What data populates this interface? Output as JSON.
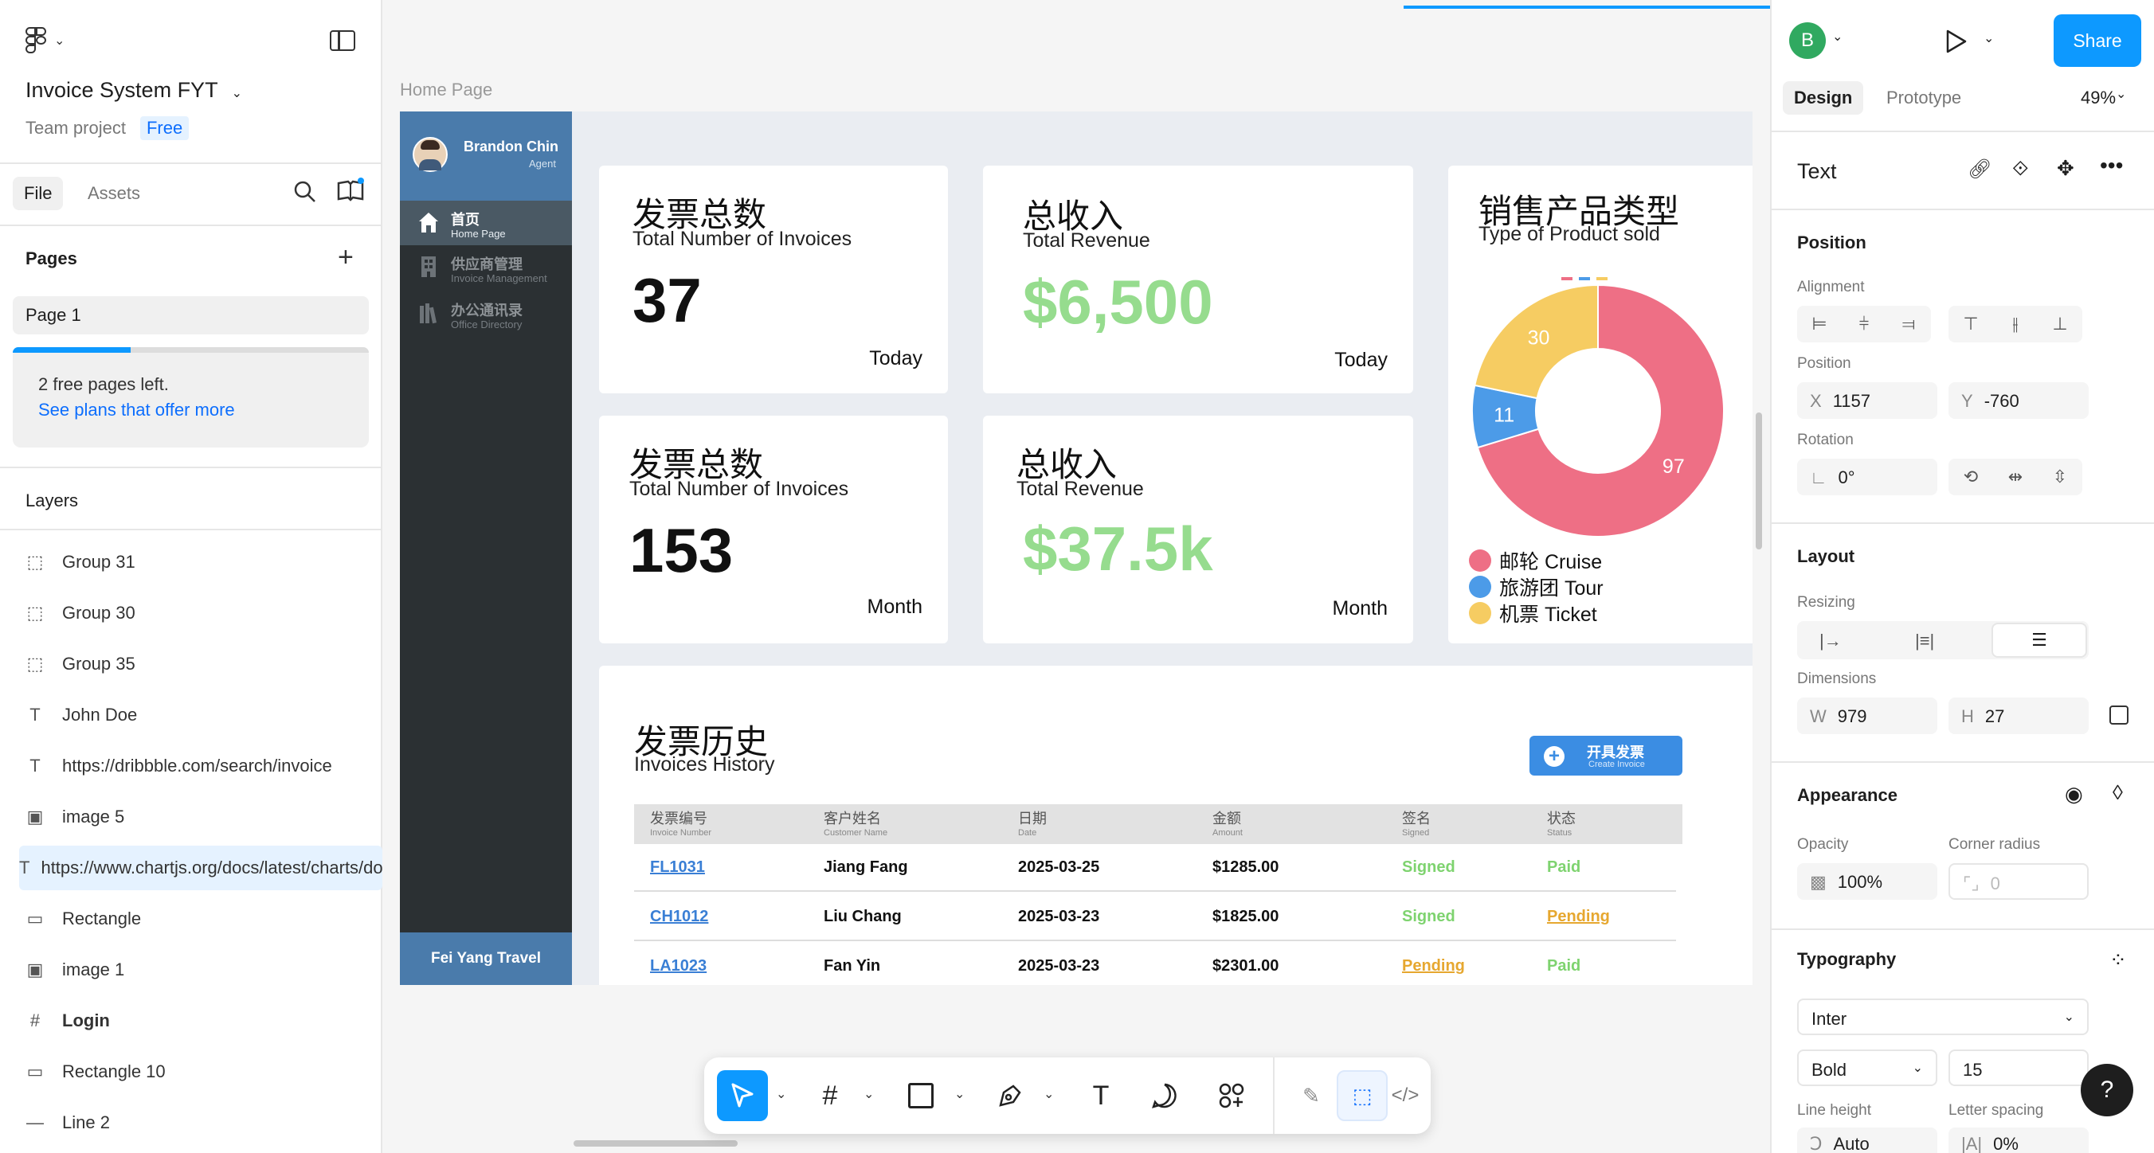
{
  "left": {
    "project_title": "Invoice System FYT",
    "project_team": "Team project",
    "project_plan": "Free",
    "tabs": [
      "File",
      "Assets"
    ],
    "pages_heading": "Pages",
    "page_item": "Page 1",
    "free_pages": "2 free pages left.",
    "see_plans": "See plans that offer more",
    "layers_heading": "Layers",
    "layers": [
      {
        "icon": "group-icon",
        "glyph": "⬚",
        "label": "Group 31"
      },
      {
        "icon": "group-icon",
        "glyph": "⬚",
        "label": "Group 30"
      },
      {
        "icon": "group-icon",
        "glyph": "⬚",
        "label": "Group 35"
      },
      {
        "icon": "text-icon",
        "glyph": "T",
        "label": "John Doe"
      },
      {
        "icon": "text-icon",
        "glyph": "T",
        "label": "https://dribbble.com/search/invoice"
      },
      {
        "icon": "image-icon",
        "glyph": "▣",
        "label": "image 5"
      },
      {
        "icon": "text-icon",
        "glyph": "T",
        "label": "https://www.chartjs.org/docs/latest/charts/doughnut.html"
      },
      {
        "icon": "rectangle-icon",
        "glyph": "▭",
        "label": "Rectangle"
      },
      {
        "icon": "image-icon",
        "glyph": "▣",
        "label": "image 1"
      },
      {
        "icon": "frame-icon",
        "glyph": "#",
        "label": "Login"
      },
      {
        "icon": "rectangle-icon",
        "glyph": "▭",
        "label": "Rectangle 10"
      },
      {
        "icon": "line-icon",
        "glyph": "—",
        "label": "Line 2"
      }
    ]
  },
  "canvas": {
    "frame_label": "Home Page",
    "sidebar": {
      "user_name": "Brandon Chin",
      "user_role": "Agent",
      "items": [
        {
          "zh": "首页",
          "en": "Home Page"
        },
        {
          "zh": "供应商管理",
          "en": "Invoice Management"
        },
        {
          "zh": "办公通讯录",
          "en": "Office Directory"
        }
      ],
      "footer": "Fei Yang Travel"
    },
    "cards": [
      {
        "zh": "发票总数",
        "en": "Total Number of Invoices",
        "value": "37",
        "period": "Today"
      },
      {
        "zh": "总收入",
        "en": "Total Revenue",
        "value": "$6,500",
        "period": "Today"
      },
      {
        "zh": "发票总数",
        "en": "Total Number of Invoices",
        "value": "153",
        "period": "Month"
      },
      {
        "zh": "总收入",
        "en": "Total Revenue",
        "value": "$37.5k",
        "period": "Month"
      }
    ],
    "chart_title_zh": "销售产品类型",
    "chart_title_en": "Type of Product sold",
    "history": {
      "zh": "发票历史",
      "en": "Invoices History",
      "create_zh": "开具发票",
      "create_en": "Create Invoice",
      "columns": [
        {
          "zh": "发票编号",
          "en": "Invoice Number"
        },
        {
          "zh": "客户姓名",
          "en": "Customer Name"
        },
        {
          "zh": "日期",
          "en": "Date"
        },
        {
          "zh": "金额",
          "en": "Amount"
        },
        {
          "zh": "签名",
          "en": "Signed"
        },
        {
          "zh": "状态",
          "en": "Status"
        }
      ],
      "rows": [
        {
          "id": "FL1031",
          "name": "Jiang Fang",
          "date": "2025-03-25",
          "amount": "$1285.00",
          "signed": "Signed",
          "status": "Paid"
        },
        {
          "id": "CH1012",
          "name": "Liu Chang",
          "date": "2025-03-23",
          "amount": "$1825.00",
          "signed": "Signed",
          "status": "Pending"
        },
        {
          "id": "LA1023",
          "name": "Fan Yin",
          "date": "2025-03-23",
          "amount": "$2301.00",
          "signed": "Pending",
          "status": "Paid"
        }
      ]
    }
  },
  "chart_data": {
    "type": "pie",
    "categories": [
      "邮轮 Cruise",
      "旅游团 Tour",
      "机票 Ticket"
    ],
    "values": [
      97,
      11,
      30
    ],
    "colors": [
      "#ee6f85",
      "#4c9be8",
      "#f6cc62"
    ],
    "title": "销售产品类型",
    "subtitle": "Type of Product sold",
    "legend": "bottom"
  },
  "right": {
    "avatar_letter": "B",
    "share": "Share",
    "tabs": [
      "Design",
      "Prototype"
    ],
    "zoom": "49%",
    "layer_type": "Text",
    "position_heading": "Position",
    "alignment_label": "Alignment",
    "position_label": "Position",
    "x_label": "X",
    "x_value": "1157",
    "y_label": "Y",
    "y_value": "-760",
    "rotation_label": "Rotation",
    "rotation_value": "0°",
    "layout_heading": "Layout",
    "resizing_label": "Resizing",
    "dimensions_label": "Dimensions",
    "w_label": "W",
    "w_value": "979",
    "h_label": "H",
    "h_value": "27",
    "appearance_heading": "Appearance",
    "opacity_label": "Opacity",
    "opacity_value": "100%",
    "corner_label": "Corner radius",
    "corner_value": "0",
    "typography_heading": "Typography",
    "font_family": "Inter",
    "font_weight": "Bold",
    "font_size": "15",
    "line_height_label": "Line height",
    "letter_spacing_label": "Letter spacing",
    "line_height_value": "Auto",
    "letter_spacing_value": "0%",
    "help": "?"
  }
}
